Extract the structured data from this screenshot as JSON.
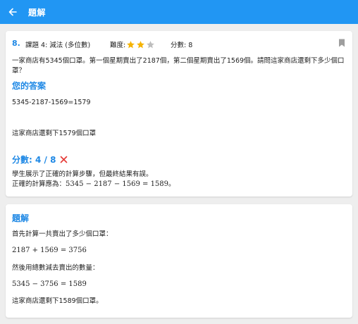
{
  "appbar": {
    "title": "題解"
  },
  "question": {
    "number": "8.",
    "topic": "課題 4: 減法 (多位數)",
    "difficulty_label": "難度:",
    "difficulty_stars": 2,
    "difficulty_max": 3,
    "score_label": "分數: 8",
    "text": "一家商店有5345個口罩。第一個星期賣出了2187個，第二個星期賣出了1569個。請問這家商店還剩下多少個口罩？"
  },
  "answer": {
    "title": "您的答案",
    "working": "5345-2187-1569=1579",
    "conclusion": "這家商店還剩下1579個口罩",
    "score": "分數: 4 / 8",
    "feedback_line1": "學生展示了正確的計算步驟，但最終結果有誤。",
    "feedback_line2_prefix": "正確的計算應為：",
    "feedback_line2_math": "5345 − 2187 − 1569 = 1589",
    "feedback_line2_suffix": "。"
  },
  "solution": {
    "title": "題解",
    "step1_text": "首先計算一共賣出了多少個口罩：",
    "step1_math": "2187 + 1569 = 3756",
    "step2_text": "然後用總數減去賣出的數量：",
    "step2_math": "5345 − 3756 = 1589",
    "conclusion": "這家商店還剩下1589個口罩。"
  },
  "colors": {
    "primary": "#2196f3",
    "accent_text": "#1e88e5",
    "star_filled": "#f5b301",
    "star_empty": "#bdbdbd",
    "error": "#e53935"
  },
  "icons": {
    "back": "arrow-left-icon",
    "bookmark": "bookmark-icon",
    "star": "star-icon",
    "wrong": "close-icon"
  }
}
